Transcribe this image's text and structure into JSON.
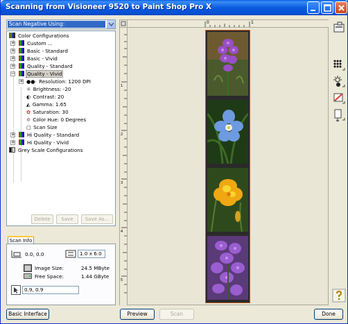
{
  "window": {
    "title": "Scanning from Visioneer 9520 to Paint Shop Pro X"
  },
  "left": {
    "scan_mode": "Scan Negative Using:",
    "tree": [
      {
        "label": "Color Configurations",
        "icon": "color-config-icon"
      },
      {
        "label": "Custom ...",
        "icon": "config-icon"
      },
      {
        "label": "Basic - Standard",
        "icon": "config-icon"
      },
      {
        "label": "Basic - Vivid",
        "icon": "config-icon"
      },
      {
        "label": "Quality - Standard",
        "icon": "config-icon"
      },
      {
        "label": "Quality - Vivid",
        "icon": "config-icon"
      },
      {
        "label": "Resolution: 1200 DPI",
        "icon": "resolution-icon"
      },
      {
        "label": "Brightness: -20",
        "icon": "brightness-icon"
      },
      {
        "label": "Contrast: 20",
        "icon": "contrast-icon"
      },
      {
        "label": "Gamma: 1.65",
        "icon": "gamma-icon"
      },
      {
        "label": "Saturation: 30",
        "icon": "saturation-icon"
      },
      {
        "label": "Color Hue: 0 Degrees",
        "icon": "color-hue-icon"
      },
      {
        "label": "Scan Size",
        "icon": "scan-size-icon"
      },
      {
        "label": "Hi Quality - Standard",
        "icon": "config-icon"
      },
      {
        "label": "Hi Quality - Vivid",
        "icon": "config-icon"
      },
      {
        "label": "Grey Scale Configurations",
        "icon": "grey-config-icon"
      }
    ],
    "buttons": {
      "delete": "Delete",
      "save": "Save",
      "save_as": "Save As..."
    }
  },
  "scan_info": {
    "tab": "Scan Info",
    "origin": "0.0, 0.0",
    "size": "1.0 x 6.0",
    "image_size_label": "Image Size:",
    "image_size_value": "24.5 MByte",
    "free_space_label": "Free Space:",
    "free_space_value": "1.44 GByte",
    "pointer": "0.9, 0.9"
  },
  "ruler": {
    "h_marks": [
      "0",
      "1"
    ],
    "v_marks": [
      "1",
      "2",
      "3",
      "4",
      "5"
    ]
  },
  "bottom": {
    "basic_interface": "Basic Interface",
    "preview": "Preview",
    "scan": "Scan",
    "done": "Done"
  },
  "colors": {
    "title_blue": "#0b5be0",
    "selection": "#316ac5",
    "frame_border": "#c45a1a"
  }
}
